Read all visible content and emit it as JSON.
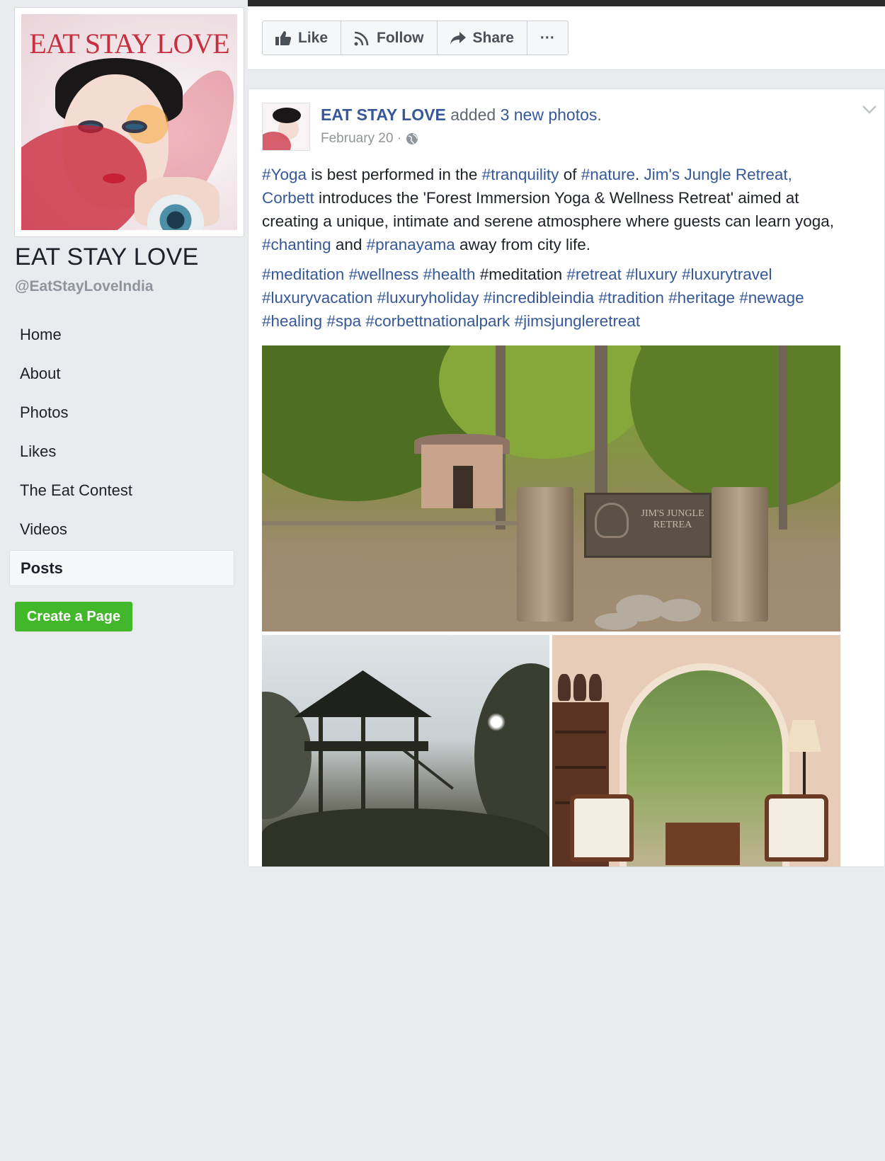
{
  "page": {
    "name": "EAT STAY LOVE",
    "handle": "@EatStayLoveIndia",
    "cover_title": "EAT STAY LOVE"
  },
  "nav": {
    "items": [
      {
        "label": "Home"
      },
      {
        "label": "About"
      },
      {
        "label": "Photos"
      },
      {
        "label": "Likes"
      },
      {
        "label": "The Eat Contest"
      },
      {
        "label": "Videos"
      },
      {
        "label": "Posts"
      }
    ],
    "active": "Posts",
    "create_page": "Create a Page"
  },
  "actions": {
    "like": "Like",
    "follow": "Follow",
    "share": "Share",
    "more": "···"
  },
  "post": {
    "author": "EAT STAY LOVE",
    "action_prefix": "added",
    "action_link": "3 new photos",
    "action_suffix": ".",
    "date": "February 20",
    "date_sep": "·",
    "text": {
      "t1": "#Yoga",
      "t2": " is best performed in the ",
      "t3": "#tranquility",
      "t4": " of ",
      "t5": "#nature",
      "t6": ". ",
      "t7": "Jim's Jungle Retreat, Corbett",
      "t8": " introduces the 'Forest Immersion Yoga & Wellness Retreat' aimed at creating a unique, intimate and serene atmosphere where guests can learn yoga, ",
      "t9": "#chanting",
      "t10": " and ",
      "t11": "#pranayama",
      "t12": " away from city life."
    },
    "hashtags": {
      "h1": "#meditation",
      "h2": "#wellness",
      "h3": "#health",
      "h4": "#meditation",
      "h5": "#retreat",
      "h6": "#luxury",
      "h7": "#luxurytravel",
      "h8": "#luxuryvacation",
      "h9": "#luxuryholiday",
      "h10": "#incredibleindia",
      "h11": "#tradition",
      "h12": "#heritage",
      "h13": "#newage",
      "h14": "#healing",
      "h15": "#spa",
      "h16": "#corbettnationalpark",
      "h17": "#jimsjungleretreat"
    },
    "sign_text": "JIM'S JUNGLE RETREA"
  },
  "colors": {
    "link": "#365899",
    "create_button": "#42b72a",
    "background": "#e9ebee"
  }
}
